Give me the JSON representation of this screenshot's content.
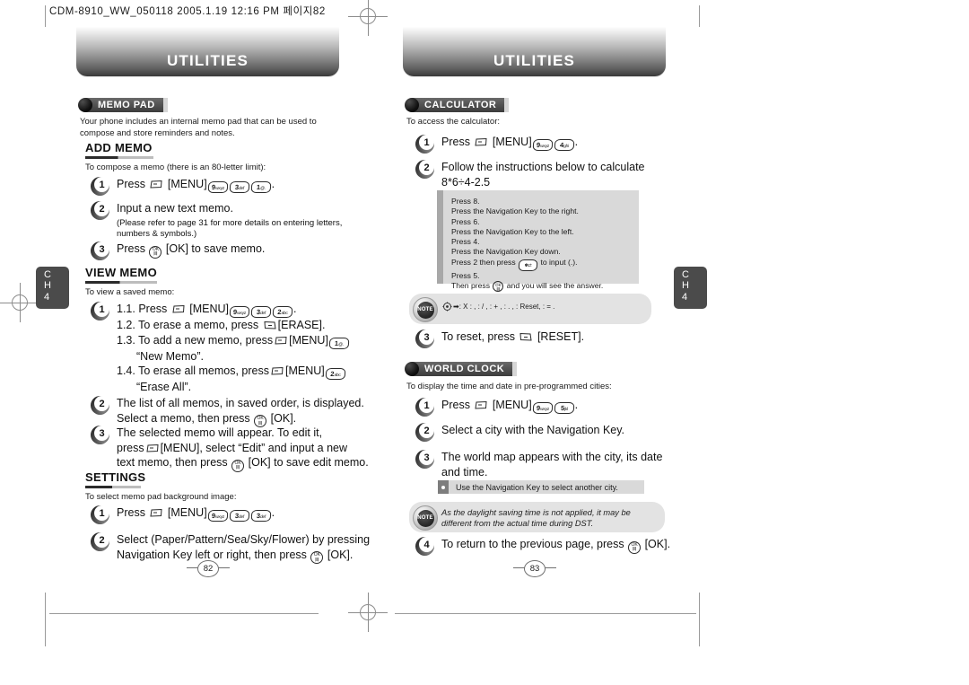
{
  "print_slug": "CDM-8910_WW_050118  2005.1.19 12:16 PM  페이지82",
  "chapter_tab": {
    "ch_line1": "C",
    "ch_line2": "H",
    "number": "4"
  },
  "left_page": {
    "banner_title": "UTILITIES",
    "page_number": "82",
    "sections": [
      {
        "name": "MEMO PAD",
        "intro": "Your phone includes an internal memo pad that can be used to compose and store reminders and notes."
      }
    ],
    "add_memo": {
      "heading": "ADD MEMO",
      "lead": "To compose a memo (there is an 80-letter limit):",
      "steps": [
        {
          "n": "1",
          "text_pre": "Press",
          "text_post": "[MENU]",
          "keys": [
            "9",
            "3",
            "1"
          ]
        },
        {
          "n": "2",
          "text": "Input a new text memo.",
          "note": "(Please refer to page 31 for more details on entering letters, numbers & symbols.)"
        },
        {
          "n": "3",
          "text_pre": "Press",
          "text_post": "[OK] to save memo."
        }
      ]
    },
    "view_memo": {
      "heading": "VIEW MEMO",
      "lead": "To view a saved memo:",
      "step1": {
        "n": "1",
        "l1_pre": "1.1. Press",
        "l1_post": "[MENU]",
        "l1_keys": [
          "9",
          "3",
          "2"
        ],
        "l2_pre": "1.2. To erase a memo, press",
        "l2_post": "[ERASE].",
        "l3_pre": "1.3. To add a new memo, press",
        "l3_post": "[MENU]",
        "l3_keys": [
          "1"
        ],
        "l3_quote": "“New Memo”.",
        "l4_pre": "1.4. To erase all memos, press",
        "l4_post": "[MENU]",
        "l4_keys": [
          "2"
        ],
        "l4_quote": "“Erase All”."
      },
      "step2": {
        "n": "2",
        "line1": "The list of all memos, in saved order, is displayed.",
        "line2_pre": "Select a memo, then press",
        "line2_post": "[OK]."
      },
      "step3": {
        "n": "3",
        "line1": "The selected memo will appear.  To edit it,",
        "line2_pre": "press",
        "line2_post": "[MENU], select “Edit” and input a new",
        "line3_pre": "text memo, then press",
        "line3_post": "[OK] to save edit memo."
      }
    },
    "settings": {
      "heading": "SETTINGS",
      "lead": "To select memo pad background image:",
      "steps": [
        {
          "n": "1",
          "text_pre": "Press",
          "text_post": "[MENU]",
          "keys": [
            "9",
            "3",
            "3"
          ]
        },
        {
          "n": "2",
          "line1": "Select (Paper/Pattern/Sea/Sky/Flower) by pressing",
          "line2_pre": "Navigation Key left or right, then press",
          "line2_post": "[OK]."
        }
      ]
    }
  },
  "right_page": {
    "banner_title": "UTILITIES",
    "page_number": "83",
    "calculator": {
      "name": "CALCULATOR",
      "lead": "To access the calculator:",
      "step1": {
        "n": "1",
        "text_pre": "Press",
        "text_post": "[MENU]",
        "keys": [
          "9",
          "4"
        ]
      },
      "step2": {
        "n": "2",
        "line1": "Follow the instructions below to calculate",
        "line2": "8*6÷4-2.5"
      },
      "instruction_box": [
        "Press 8.",
        "Press the Navigation Key to the right.",
        "Press 6.",
        "Press the Navigation Key to the left.",
        "Press 4.",
        "Press the Navigation Key down.",
        "Press 2 then press",
        "Press 5.",
        "Then press"
      ],
      "box_line7_post": "to input (.).",
      "box_line9_post": "and you will see the answer.",
      "note_label": "NOTE",
      "legend": ": X           : ,      : / ,      : + ,      : . ,      : Reset,      : = .",
      "step3": {
        "n": "3",
        "text_pre": "To reset, press",
        "text_post": "[RESET]."
      }
    },
    "world_clock": {
      "name": "WORLD CLOCK",
      "lead": "To display the time and date in pre-programmed cities:",
      "step1": {
        "n": "1",
        "text_pre": "Press",
        "text_post": "[MENU]",
        "keys": [
          "9",
          "5"
        ]
      },
      "step2": {
        "n": "2",
        "text": "Select a city with the Navigation Key."
      },
      "step3": {
        "n": "3",
        "line1": "The world map appears with the city, its date",
        "line2": "and time."
      },
      "tip": "Use the Navigation Key to select another city.",
      "note_label": "NOTE",
      "note_text": "As the daylight saving time is not applied, it may be different from the actual time during DST.",
      "step4": {
        "n": "4",
        "text_pre": "To return to the previous page, press",
        "text_post": "[OK]."
      }
    }
  }
}
